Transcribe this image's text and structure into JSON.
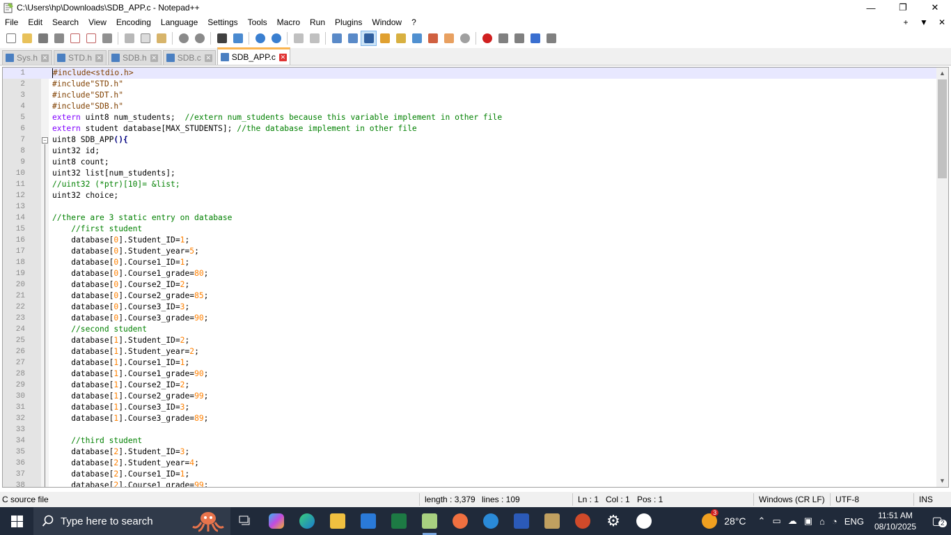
{
  "window": {
    "title": "C:\\Users\\hp\\Downloads\\SDB_APP.c - Notepad++"
  },
  "menu": {
    "items": [
      "File",
      "Edit",
      "Search",
      "View",
      "Encoding",
      "Language",
      "Settings",
      "Tools",
      "Macro",
      "Run",
      "Plugins",
      "Window",
      "?"
    ],
    "right": [
      "+",
      "▼",
      "✕"
    ]
  },
  "tabs": [
    {
      "label": "Sys.h",
      "active": false
    },
    {
      "label": "STD.h",
      "active": false
    },
    {
      "label": "SDB.h",
      "active": false
    },
    {
      "label": "SDB.c",
      "active": false
    },
    {
      "label": "SDB_APP.c",
      "active": true
    }
  ],
  "editor": {
    "lines": [
      {
        "n": "1",
        "parts": [
          {
            "c": "pp",
            "t": "#include<stdio.h>"
          }
        ]
      },
      {
        "n": "2",
        "parts": [
          {
            "c": "pp",
            "t": "#include\"STD.h\""
          }
        ]
      },
      {
        "n": "3",
        "parts": [
          {
            "c": "pp",
            "t": "#include\"SDT.h\""
          }
        ]
      },
      {
        "n": "4",
        "parts": [
          {
            "c": "pp",
            "t": "#include\"SDB.h\""
          }
        ]
      },
      {
        "n": "5",
        "parts": [
          {
            "c": "kw",
            "t": "extern"
          },
          {
            "c": "",
            "t": " uint8 num_students;  "
          },
          {
            "c": "cm",
            "t": "//extern num_students because this variable implement in other file"
          }
        ]
      },
      {
        "n": "6",
        "parts": [
          {
            "c": "kw",
            "t": "extern"
          },
          {
            "c": "",
            "t": " student database[MAX_STUDENTS]; "
          },
          {
            "c": "cm",
            "t": "//the database implement in other file"
          }
        ]
      },
      {
        "n": "7",
        "parts": [
          {
            "c": "",
            "t": "uint8 SDB_APP"
          },
          {
            "c": "op",
            "t": "(){"
          }
        ]
      },
      {
        "n": "8",
        "parts": [
          {
            "c": "",
            "t": "uint32 id;"
          }
        ]
      },
      {
        "n": "9",
        "parts": [
          {
            "c": "",
            "t": "uint8 count;"
          }
        ]
      },
      {
        "n": "10",
        "parts": [
          {
            "c": "",
            "t": "uint32 list[num_students];"
          }
        ]
      },
      {
        "n": "11",
        "parts": [
          {
            "c": "cm",
            "t": "//uint32 (*ptr)[10]= &list;"
          }
        ]
      },
      {
        "n": "12",
        "parts": [
          {
            "c": "",
            "t": "uint32 choice;"
          }
        ]
      },
      {
        "n": "13",
        "parts": []
      },
      {
        "n": "14",
        "parts": [
          {
            "c": "cm",
            "t": "//there are 3 static entry on database"
          }
        ]
      },
      {
        "n": "15",
        "parts": [
          {
            "c": "cm",
            "t": "    //first student"
          }
        ]
      },
      {
        "n": "16",
        "parts": [
          {
            "c": "",
            "t": "    database["
          },
          {
            "c": "num",
            "t": "0"
          },
          {
            "c": "",
            "t": "].Student_ID="
          },
          {
            "c": "num",
            "t": "1"
          },
          {
            "c": "",
            "t": ";"
          }
        ]
      },
      {
        "n": "17",
        "parts": [
          {
            "c": "",
            "t": "    database["
          },
          {
            "c": "num",
            "t": "0"
          },
          {
            "c": "",
            "t": "].Student_year="
          },
          {
            "c": "num",
            "t": "5"
          },
          {
            "c": "",
            "t": ";"
          }
        ]
      },
      {
        "n": "18",
        "parts": [
          {
            "c": "",
            "t": "    database["
          },
          {
            "c": "num",
            "t": "0"
          },
          {
            "c": "",
            "t": "].Course1_ID="
          },
          {
            "c": "num",
            "t": "1"
          },
          {
            "c": "",
            "t": ";"
          }
        ]
      },
      {
        "n": "19",
        "parts": [
          {
            "c": "",
            "t": "    database["
          },
          {
            "c": "num",
            "t": "0"
          },
          {
            "c": "",
            "t": "].Course1_grade="
          },
          {
            "c": "num",
            "t": "80"
          },
          {
            "c": "",
            "t": ";"
          }
        ]
      },
      {
        "n": "20",
        "parts": [
          {
            "c": "",
            "t": "    database["
          },
          {
            "c": "num",
            "t": "0"
          },
          {
            "c": "",
            "t": "].Course2_ID="
          },
          {
            "c": "num",
            "t": "2"
          },
          {
            "c": "",
            "t": ";"
          }
        ]
      },
      {
        "n": "21",
        "parts": [
          {
            "c": "",
            "t": "    database["
          },
          {
            "c": "num",
            "t": "0"
          },
          {
            "c": "",
            "t": "].Course2_grade="
          },
          {
            "c": "num",
            "t": "85"
          },
          {
            "c": "",
            "t": ";"
          }
        ]
      },
      {
        "n": "22",
        "parts": [
          {
            "c": "",
            "t": "    database["
          },
          {
            "c": "num",
            "t": "0"
          },
          {
            "c": "",
            "t": "].Course3_ID="
          },
          {
            "c": "num",
            "t": "3"
          },
          {
            "c": "",
            "t": ";"
          }
        ]
      },
      {
        "n": "23",
        "parts": [
          {
            "c": "",
            "t": "    database["
          },
          {
            "c": "num",
            "t": "0"
          },
          {
            "c": "",
            "t": "].Course3_grade="
          },
          {
            "c": "num",
            "t": "90"
          },
          {
            "c": "",
            "t": ";"
          }
        ]
      },
      {
        "n": "24",
        "parts": [
          {
            "c": "cm",
            "t": "    //second student"
          }
        ]
      },
      {
        "n": "25",
        "parts": [
          {
            "c": "",
            "t": "    database["
          },
          {
            "c": "num",
            "t": "1"
          },
          {
            "c": "",
            "t": "].Student_ID="
          },
          {
            "c": "num",
            "t": "2"
          },
          {
            "c": "",
            "t": ";"
          }
        ]
      },
      {
        "n": "26",
        "parts": [
          {
            "c": "",
            "t": "    database["
          },
          {
            "c": "num",
            "t": "1"
          },
          {
            "c": "",
            "t": "].Student_year="
          },
          {
            "c": "num",
            "t": "2"
          },
          {
            "c": "",
            "t": ";"
          }
        ]
      },
      {
        "n": "27",
        "parts": [
          {
            "c": "",
            "t": "    database["
          },
          {
            "c": "num",
            "t": "1"
          },
          {
            "c": "",
            "t": "].Course1_ID="
          },
          {
            "c": "num",
            "t": "1"
          },
          {
            "c": "",
            "t": ";"
          }
        ]
      },
      {
        "n": "28",
        "parts": [
          {
            "c": "",
            "t": "    database["
          },
          {
            "c": "num",
            "t": "1"
          },
          {
            "c": "",
            "t": "].Course1_grade="
          },
          {
            "c": "num",
            "t": "90"
          },
          {
            "c": "",
            "t": ";"
          }
        ]
      },
      {
        "n": "29",
        "parts": [
          {
            "c": "",
            "t": "    database["
          },
          {
            "c": "num",
            "t": "1"
          },
          {
            "c": "",
            "t": "].Course2_ID="
          },
          {
            "c": "num",
            "t": "2"
          },
          {
            "c": "",
            "t": ";"
          }
        ]
      },
      {
        "n": "30",
        "parts": [
          {
            "c": "",
            "t": "    database["
          },
          {
            "c": "num",
            "t": "1"
          },
          {
            "c": "",
            "t": "].Course2_grade="
          },
          {
            "c": "num",
            "t": "99"
          },
          {
            "c": "",
            "t": ";"
          }
        ]
      },
      {
        "n": "31",
        "parts": [
          {
            "c": "",
            "t": "    database["
          },
          {
            "c": "num",
            "t": "1"
          },
          {
            "c": "",
            "t": "].Course3_ID="
          },
          {
            "c": "num",
            "t": "3"
          },
          {
            "c": "",
            "t": ";"
          }
        ]
      },
      {
        "n": "32",
        "parts": [
          {
            "c": "",
            "t": "    database["
          },
          {
            "c": "num",
            "t": "1"
          },
          {
            "c": "",
            "t": "].Course3_grade="
          },
          {
            "c": "num",
            "t": "89"
          },
          {
            "c": "",
            "t": ";"
          }
        ]
      },
      {
        "n": "33",
        "parts": []
      },
      {
        "n": "34",
        "parts": [
          {
            "c": "cm",
            "t": "    //third student"
          }
        ]
      },
      {
        "n": "35",
        "parts": [
          {
            "c": "",
            "t": "    database["
          },
          {
            "c": "num",
            "t": "2"
          },
          {
            "c": "",
            "t": "].Student_ID="
          },
          {
            "c": "num",
            "t": "3"
          },
          {
            "c": "",
            "t": ";"
          }
        ]
      },
      {
        "n": "36",
        "parts": [
          {
            "c": "",
            "t": "    database["
          },
          {
            "c": "num",
            "t": "2"
          },
          {
            "c": "",
            "t": "].Student_year="
          },
          {
            "c": "num",
            "t": "4"
          },
          {
            "c": "",
            "t": ";"
          }
        ]
      },
      {
        "n": "37",
        "parts": [
          {
            "c": "",
            "t": "    database["
          },
          {
            "c": "num",
            "t": "2"
          },
          {
            "c": "",
            "t": "].Course1_ID="
          },
          {
            "c": "num",
            "t": "1"
          },
          {
            "c": "",
            "t": ";"
          }
        ]
      },
      {
        "n": "38",
        "parts": [
          {
            "c": "",
            "t": "    database["
          },
          {
            "c": "num",
            "t": "2"
          },
          {
            "c": "",
            "t": "].Course1_grade="
          },
          {
            "c": "num",
            "t": "99"
          },
          {
            "c": "",
            "t": ";"
          }
        ]
      }
    ]
  },
  "status": {
    "filetype": "C source file",
    "length": "length : 3,379",
    "lines": "lines : 109",
    "ln": "Ln : 1",
    "col": "Col : 1",
    "pos": "Pos : 1",
    "eol": "Windows (CR LF)",
    "encoding": "UTF-8",
    "mode": "INS"
  },
  "taskbar": {
    "search_placeholder": "Type here to search",
    "weather_badge": "3",
    "temperature": "28°C",
    "language": "ENG",
    "time": "11:51 AM",
    "date": "08/10/2025",
    "notifications": "2"
  },
  "colors": {
    "preprocessor": "#804000",
    "keyword": "#8000ff",
    "comment": "#008000",
    "number": "#ff8000",
    "operator": "#000080",
    "active_tab_accent": "#fab450",
    "current_line": "#e8e8ff"
  }
}
